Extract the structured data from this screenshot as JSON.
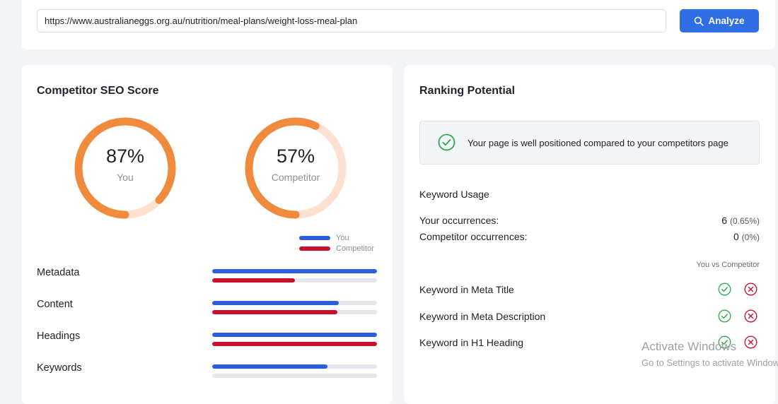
{
  "search": {
    "url_value": "https://www.australianeggs.org.au/nutrition/meal-plans/weight-loss-meal-plan",
    "analyze_label": "Analyze"
  },
  "seo_score": {
    "title": "Competitor SEO Score",
    "you": {
      "value_text": "87%",
      "label": "You",
      "percent": 87
    },
    "competitor": {
      "value_text": "57%",
      "label": "Competitor",
      "percent": 57
    },
    "legend": {
      "you": "You",
      "competitor": "Competitor"
    },
    "metrics": [
      {
        "label": "Metadata",
        "you": 100,
        "competitor": 50
      },
      {
        "label": "Content",
        "you": 77,
        "competitor": 76
      },
      {
        "label": "Headings",
        "you": 100,
        "competitor": 100
      },
      {
        "label": "Keywords",
        "you": 70,
        "competitor": 0
      }
    ]
  },
  "ranking": {
    "title": "Ranking Potential",
    "status_message": "Your page is well positioned compared to your competitors page",
    "keyword_usage": {
      "title": "Keyword Usage",
      "your_label": "Your occurrences:",
      "your_count": "6",
      "your_pct": "(0.65%)",
      "competitor_label": "Competitor occurrences:",
      "competitor_count": "0",
      "competitor_pct": "(0%)"
    },
    "vs_label": "You vs Competitor",
    "checks": [
      {
        "label": "Keyword in Meta Title",
        "you": true,
        "competitor": false
      },
      {
        "label": "Keyword in Meta Description",
        "you": true,
        "competitor": false
      },
      {
        "label": "Keyword in H1 Heading",
        "you": true,
        "competitor": false
      }
    ]
  },
  "colors": {
    "accent_blue": "#2f6ee5",
    "gauge_orange": "#f08a3c",
    "gauge_track": "#fde0d0",
    "bar_you": "#2b5fd9",
    "bar_competitor": "#c8102e",
    "check_green": "#2fa84f",
    "cross_red": "#c8102e"
  },
  "watermark": {
    "line1": "Activate Windows",
    "line2": "Go to Settings to activate Windows."
  }
}
